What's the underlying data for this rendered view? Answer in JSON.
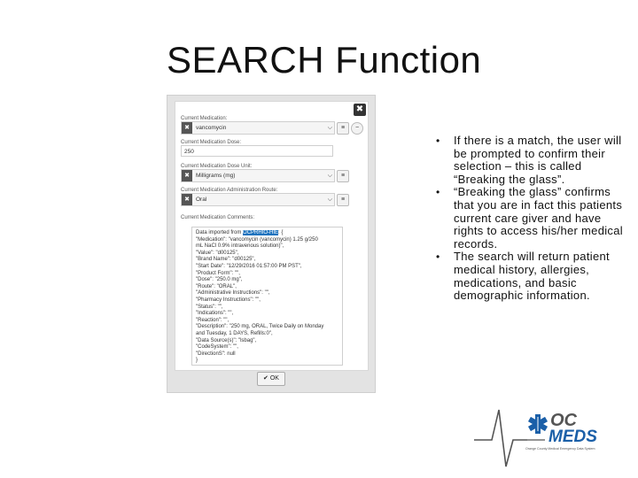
{
  "slide": {
    "title": "SEARCH Function",
    "bullets": [
      "If there is a match, the user will be prompted to confirm their selection – this is called “Breaking the glass”.",
      "“Breaking the glass” confirms that you are in fact this patients current care giver and have rights to access his/her medical records.",
      "The search will return patient medical history, allergies, medications, and basic demographic information."
    ]
  },
  "dialog": {
    "close_icon": "close-icon",
    "fields": {
      "medication_label": "Current Medication:",
      "medication_value": "vancomycin",
      "dose_label": "Current Medication Dose:",
      "dose_value": "250",
      "dose_unit_label": "Current Medication Dose Unit:",
      "dose_unit_value": "Milligrams (mg)",
      "route_label": "Current Medication Administration Route:",
      "route_value": "Oral",
      "comments_label": "Current Medication Comments:"
    },
    "comments": {
      "prefix": "Data imported from ",
      "highlight": "OCPRHIO-HIE",
      "suffix": ": {",
      "lines": [
        "\"Medication\": \"vancomycin (vancomycin) 1.25 g/250",
        "mL NaCl 0.9% intravenous solution)\",",
        "\"Value\": \"d00125\",",
        "\"Brand Name\": \"d00125\",",
        "\"Start Date\": \"12/29/2016 01:57:00 PM PST\",",
        "\"Product Form\": \"\",",
        "\"Dose\": \"250.0 mg\",",
        "\"Route\": \"ORAL\",",
        "\"Administrative Instructions\": \"\",",
        "\"Pharmacy Instructions\": \"\",",
        "\"Status\": \"\",",
        "\"Indications\": \"\",",
        "\"Reaction\": \"\",",
        "\"Description\": \"250 mg, ORAL, Twice Daily on Monday",
        "and Tuesday, 1 DAYS, Refills:0\",",
        "\"Data Source(s)\": \"lsbag\",",
        "\"CodeSystem\": \"\",",
        "\"DirectionS\": null",
        "}"
      ]
    },
    "ok_label": "OK"
  },
  "logo": {
    "text_top": "OC",
    "text_bottom": "MEDS",
    "tagline": "Orange County Medical Emergency Data System",
    "colors": {
      "blue": "#1a5fa8",
      "grey": "#555555"
    }
  },
  "colors": {
    "band_dark": "#0d2233",
    "band_mid": "#2b5f88",
    "highlight": "#1e73be"
  }
}
